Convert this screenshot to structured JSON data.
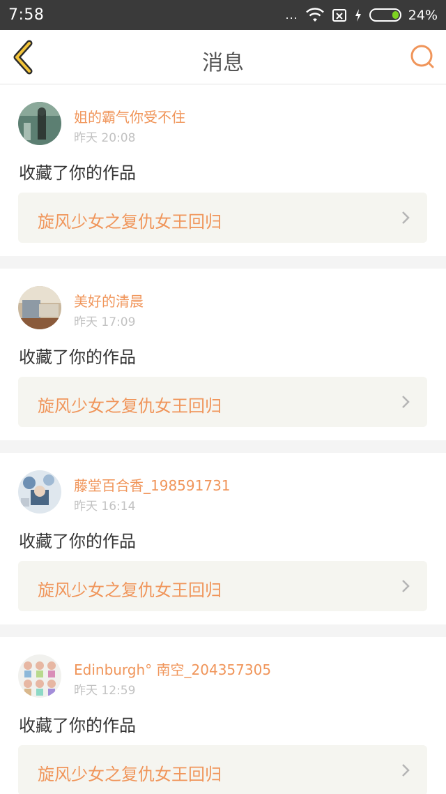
{
  "status_bar": {
    "time": "7:58",
    "dots": "...",
    "battery_percent": "24%",
    "battery_level": 0.24,
    "battery_color": "#7ed321"
  },
  "header": {
    "title": "消息",
    "back_icon": "chevron-left-icon",
    "search_icon": "search-icon",
    "accent_color": "#f0955a"
  },
  "messages": [
    {
      "username": "姐的霸气你受不住",
      "timestamp": "昨天 20:08",
      "action": "收藏了你的作品",
      "work_title": "旋风少女之复仇女王回归"
    },
    {
      "username": "美好的清晨",
      "timestamp": "昨天 17:09",
      "action": "收藏了你的作品",
      "work_title": "旋风少女之复仇女王回归"
    },
    {
      "username": "藤堂百合香_198591731",
      "timestamp": "昨天 16:14",
      "action": "收藏了你的作品",
      "work_title": "旋风少女之复仇女王回归"
    },
    {
      "username": "Edinburgh° 南空_204357305",
      "timestamp": "昨天 12:59",
      "action": "收藏了你的作品",
      "work_title": "旋风少女之复仇女王回归"
    }
  ]
}
